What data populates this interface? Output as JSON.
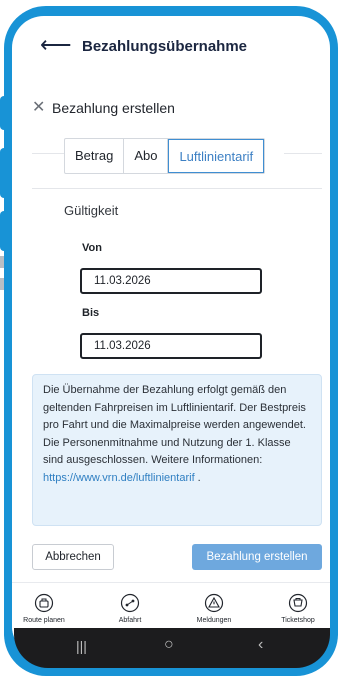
{
  "header": {
    "title": "Bezahlungsübernahme",
    "back_icon": "arrow-left-icon"
  },
  "modal": {
    "title": "Bezahlung erstellen",
    "tabs": [
      {
        "label": "Betrag",
        "active": false
      },
      {
        "label": "Abo",
        "active": false
      },
      {
        "label": "Luftlinientarif",
        "active": true
      }
    ],
    "validity_label": "Gültigkeit",
    "from_label": "Von",
    "from_value": "11.03.2026",
    "to_label": "Bis",
    "to_value": "11.03.2026",
    "info_text": "Die Übernahme der Bezahlung erfolgt gemäß den geltenden Fahrpreisen im Luftlinientarif. Der Bestpreis pro Fahrt und die Maximalpreise werden angewendet. Die Personenmitnahme und Nutzung der 1. Klasse sind ausgeschlossen. Weitere Informationen:",
    "info_link": "https://www.vrn.de/luftlinientarif",
    "info_suffix": " .",
    "cancel_label": "Abbrechen",
    "submit_label": "Bezahlung erstellen"
  },
  "bottom_nav": [
    {
      "label": "Route planen",
      "icon": "route-icon"
    },
    {
      "label": "Abfahrt",
      "icon": "departure-icon"
    },
    {
      "label": "Meldungen",
      "icon": "alert-icon"
    },
    {
      "label": "Ticketshop",
      "icon": "ticketshop-icon"
    }
  ],
  "colors": {
    "frame": "#1893d6",
    "accent": "#3d80c4",
    "info_bg": "#e7f2fb",
    "button": "#6ea8de"
  }
}
